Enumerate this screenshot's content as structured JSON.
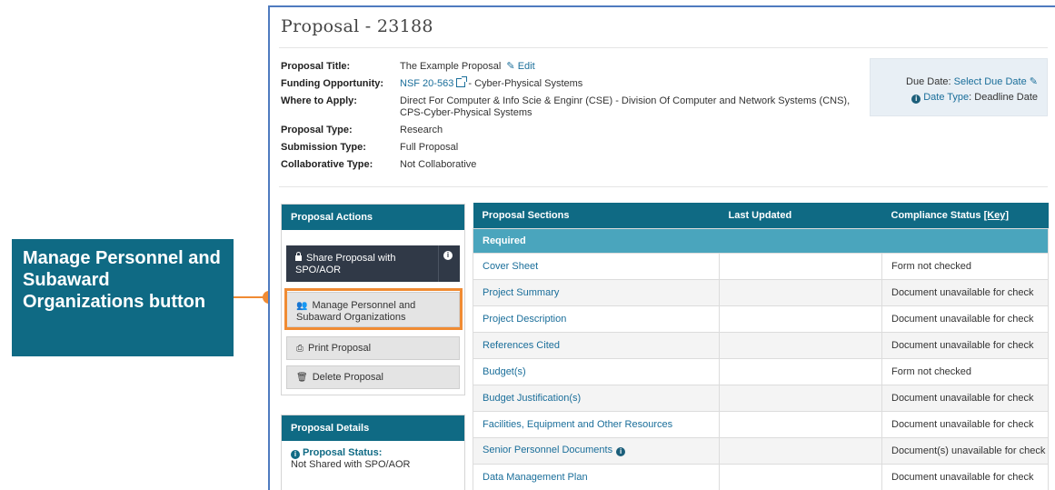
{
  "callout": {
    "text": "Manage Personnel and Subaward Organizations button"
  },
  "page": {
    "title": "Proposal - 23188"
  },
  "info": {
    "rows": [
      {
        "label": "Proposal Title:",
        "value": "The Example Proposal",
        "edit_label": "Edit"
      },
      {
        "label": "Funding Opportunity:",
        "link": "NSF 20-563",
        "value": " - Cyber-Physical Systems"
      },
      {
        "label": "Where to Apply:",
        "value": "Direct For Computer & Info Scie & Enginr (CSE) - Division Of Computer and Network Systems (CNS), CPS-Cyber-Physical Systems"
      },
      {
        "label": "Proposal Type:",
        "value": "Research"
      },
      {
        "label": "Submission Type:",
        "value": "Full Proposal"
      },
      {
        "label": "Collaborative Type:",
        "value": "Not Collaborative"
      }
    ]
  },
  "due": {
    "label": "Due Date: ",
    "link": "Select Due Date",
    "type_label": "Date Type",
    "type_value": ": Deadline Date"
  },
  "actions": {
    "header": "Proposal Actions",
    "share": "Share Proposal with SPO/AOR",
    "manage": "Manage Personnel and Subaward Organizations",
    "print": "Print Proposal",
    "delete": "Delete Proposal"
  },
  "details": {
    "header": "Proposal Details",
    "status_label": "Proposal Status:",
    "status_value": "Not Shared with SPO/AOR"
  },
  "table": {
    "headers": {
      "sections": "Proposal Sections",
      "updated": "Last Updated",
      "compliance": "Compliance Status ",
      "key": "[Key]"
    },
    "group": "Required",
    "rows": [
      {
        "section": "Cover Sheet",
        "updated": "",
        "status": "Form not checked"
      },
      {
        "section": "Project Summary",
        "updated": "",
        "status": "Document unavailable for check"
      },
      {
        "section": "Project Description",
        "updated": "",
        "status": "Document unavailable for check"
      },
      {
        "section": "References Cited",
        "updated": "",
        "status": "Document unavailable for check"
      },
      {
        "section": "Budget(s)",
        "updated": "",
        "status": "Form not checked"
      },
      {
        "section": "Budget Justification(s)",
        "updated": "",
        "status": "Document unavailable for check"
      },
      {
        "section": "Facilities, Equipment and Other Resources",
        "updated": "",
        "status": "Document unavailable for check"
      },
      {
        "section": "Senior Personnel Documents",
        "updated": "",
        "status": "Document(s) unavailable for check"
      },
      {
        "section": "Data Management Plan",
        "updated": "",
        "status": "Document unavailable for check"
      }
    ]
  }
}
